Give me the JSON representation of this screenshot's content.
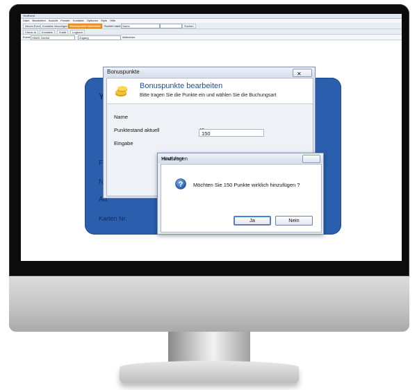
{
  "app": {
    "window_title": "YouEvent",
    "menu": [
      "Datei",
      "Bearbeiten",
      "Ansicht",
      "Fenster",
      "Kontakte",
      "Optionen",
      "Style",
      "Hilfe"
    ],
    "toolbar": {
      "new_event": "Neues Event",
      "add_contact": "Kontakte hinzufügen",
      "edit_bonus": "Bonuspunkte bearbeiten",
      "search_by_label": "Suchen nach",
      "search_field_value": "Name",
      "search_button": "Suchen"
    },
    "toolbar2": {
      "checkin": "Check-In",
      "kontakte": "Kontakte",
      "zutritt": "Zutritt",
      "logbuch": "Logbuch"
    },
    "toolbar3": {
      "event_label": "Event",
      "event_value": "XMAS Zumba",
      "zugang": "Zugang",
      "abbuchen": "Abbuchen"
    }
  },
  "background_form": {
    "labels": [
      "Yo",
      "Fi",
      "N",
      "Ad",
      "Karten Nr."
    ]
  },
  "bonus_dialog": {
    "title": "Bonuspunkte",
    "close_glyph": "✕",
    "heading": "Bonuspunkte bearbeiten",
    "subtitle": "Bitte tragen Sie die Punkte ein und wählen Sie die Buchungsart",
    "fields": {
      "name_label": "Name",
      "points_label": "Punktestand aktuell",
      "points_value": "45",
      "input_label": "Eingabe",
      "input_value": "150"
    }
  },
  "confirm_dialog": {
    "title": "YouEvent",
    "ghost_label": "Hinzufügen",
    "message": "Möchten Sie 150 Punkte wirklich hinzufügen ?",
    "yes_label": "Ja",
    "no_label": "Nein"
  },
  "colors": {
    "accent_blue": "#2b5fae",
    "heading_blue": "#1f4e9a",
    "toolbar_active": "#f39a2b"
  },
  "icons": {
    "coin": "coins-icon",
    "question": "question-icon"
  }
}
